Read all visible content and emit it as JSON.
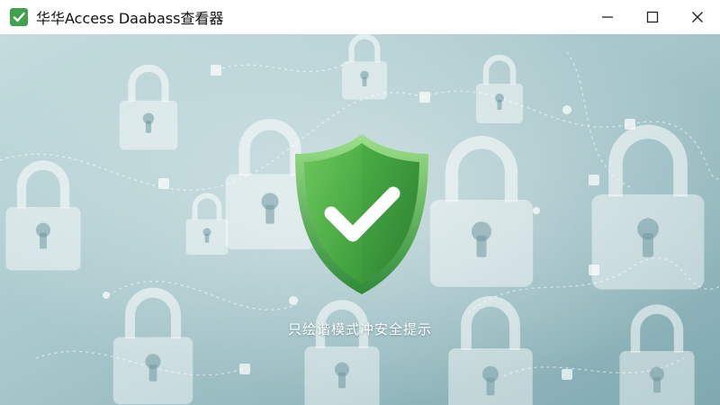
{
  "window": {
    "title": "华华Access Daabass查看器",
    "app_icon": "green-checkbox-icon",
    "controls": [
      {
        "name": "minimize-button",
        "icon": "minimize-icon"
      },
      {
        "name": "maximize-button",
        "icon": "maximize-icon"
      },
      {
        "name": "close-button",
        "icon": "close-icon"
      }
    ]
  },
  "content": {
    "caption": "只绘谐模式冲安全提示",
    "shield_icon": "shield-check-icon",
    "background": "padlock-network-pattern"
  },
  "colors": {
    "accent_green": "#4cae3f",
    "shield_dark": "#2f8a3a",
    "background_teal": "#a9c9cd",
    "caption_text": "#ffffff"
  }
}
